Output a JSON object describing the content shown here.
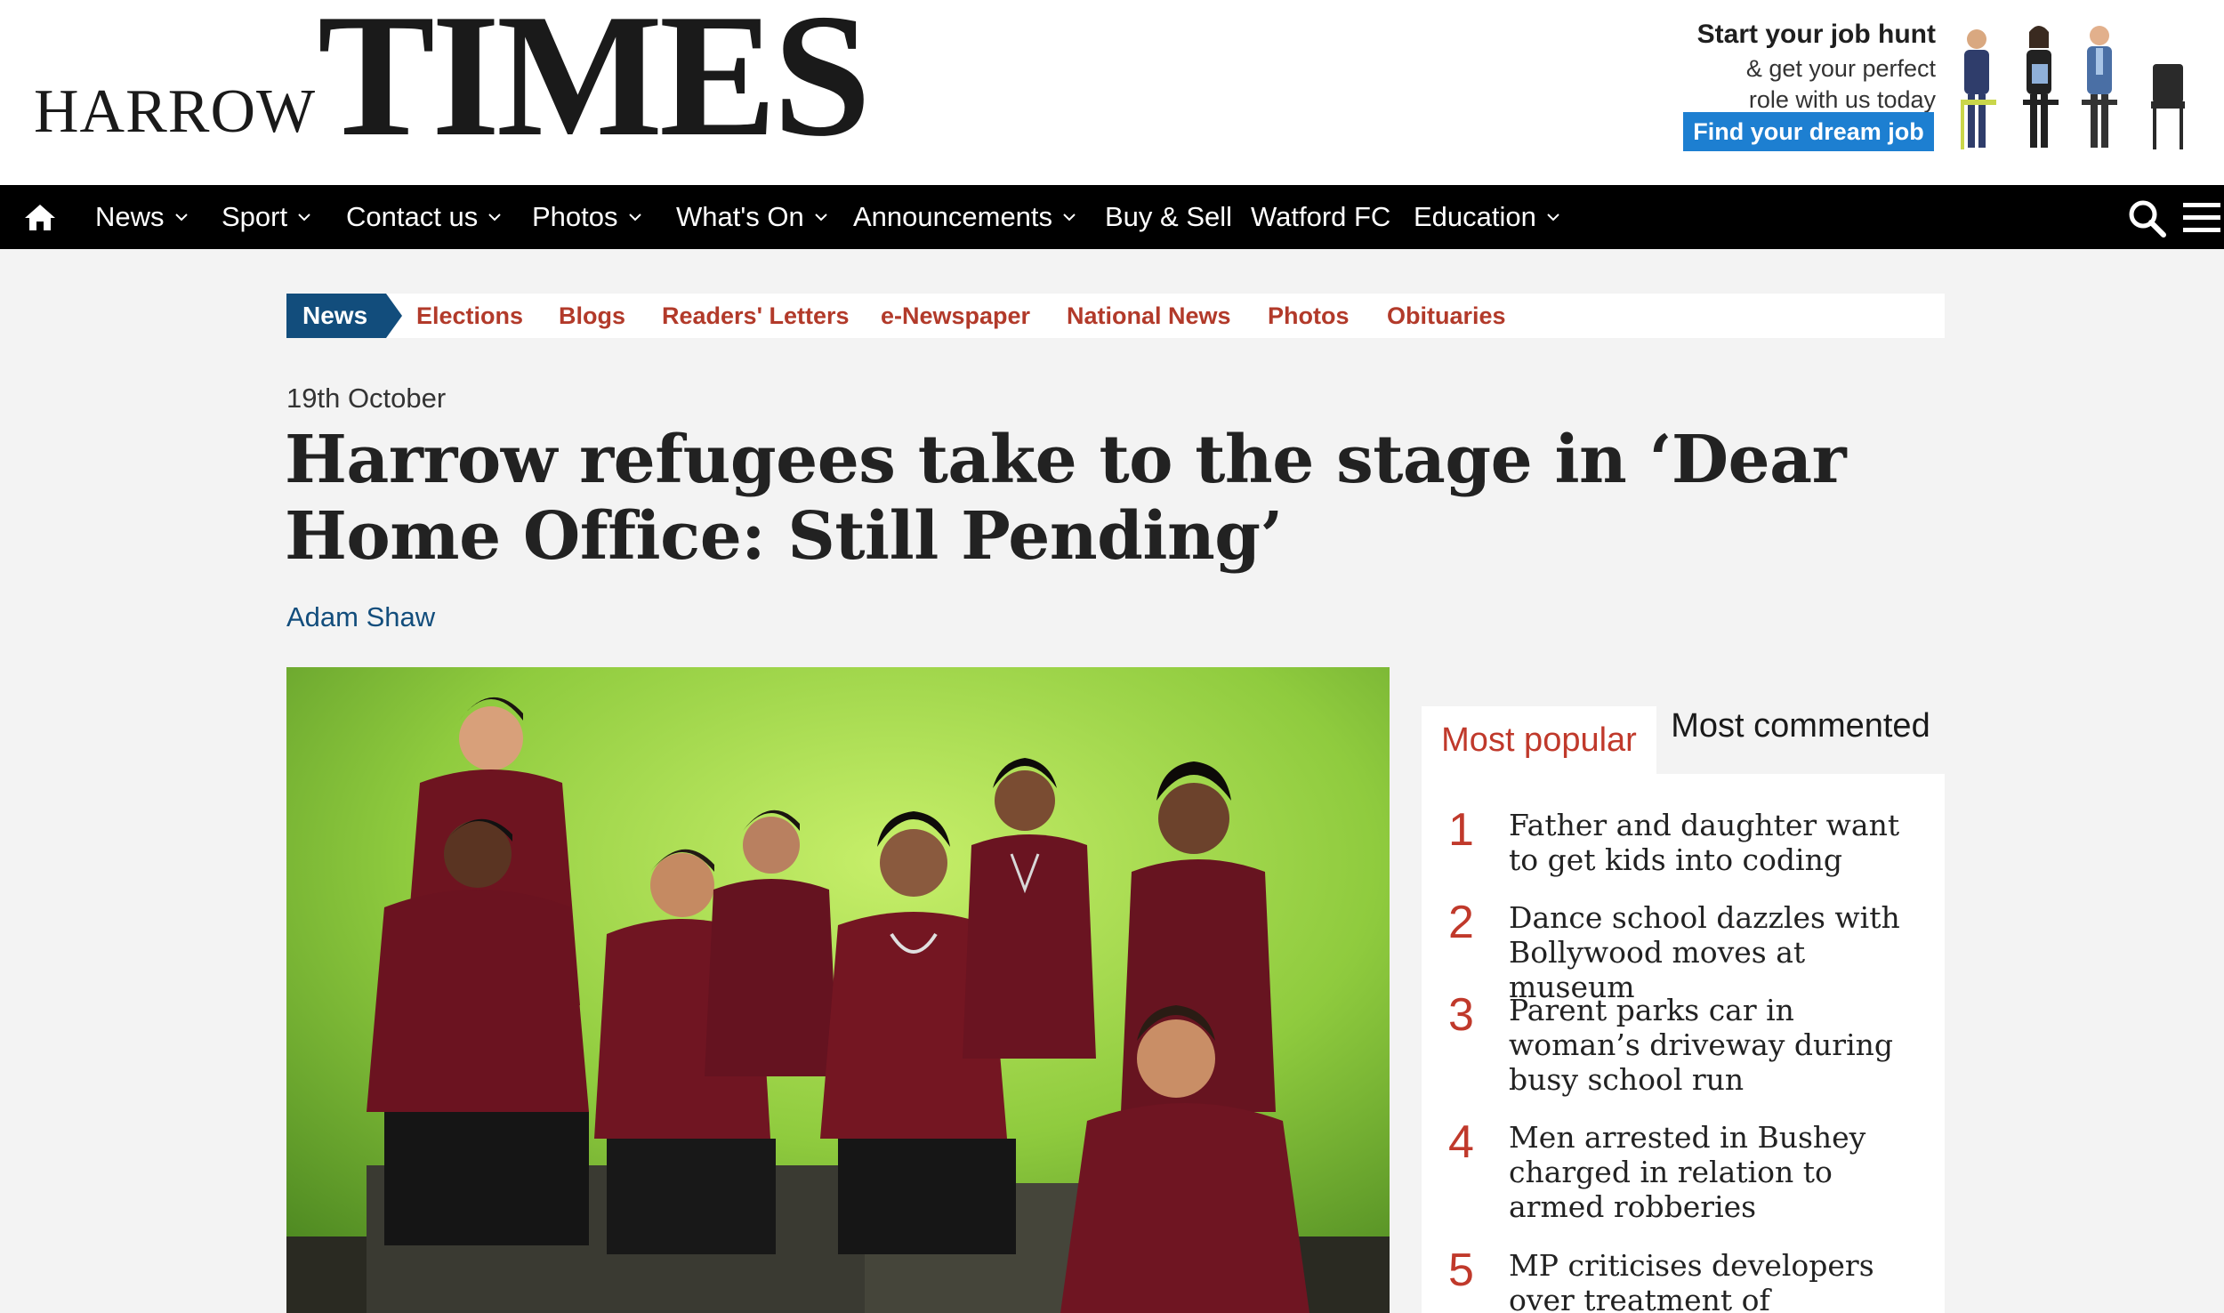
{
  "masthead": {
    "logo_small": "HARROW",
    "logo_large": "TIMES"
  },
  "ad": {
    "headline": "Start your job hunt",
    "line1": "& get your perfect",
    "line2": "role with us today",
    "button": "Find your dream job"
  },
  "nav": {
    "items": [
      "News",
      "Sport",
      "Contact us",
      "Photos",
      "What's On",
      "Announcements",
      "Buy & Sell",
      "Watford FC",
      "Education"
    ]
  },
  "section_nav": {
    "active": "News",
    "items": [
      "Elections",
      "Blogs",
      "Readers' Letters",
      "e-Newspaper",
      "National News",
      "Photos",
      "Obituaries"
    ]
  },
  "article": {
    "date": "19th October",
    "headline": "Harrow refugees take to the stage in ‘Dear Home Office: Still Pending’",
    "author": "Adam Shaw"
  },
  "sidebar": {
    "tab_popular": "Most popular",
    "tab_commented": "Most commented",
    "items": [
      {
        "num": "1",
        "title": "Father and daughter want to get kids into coding"
      },
      {
        "num": "2",
        "title": "Dance school dazzles with Bollywood moves at museum"
      },
      {
        "num": "3",
        "title": "Parent parks car in woman’s driveway during busy school run"
      },
      {
        "num": "4",
        "title": "Men arrested in Bushey charged in relation to armed robberies"
      },
      {
        "num": "5",
        "title": "MP criticises developers over treatment of leaseholders"
      }
    ]
  },
  "colors": {
    "nav_bg": "#000000",
    "section_active": "#124d7c",
    "section_link": "#b23a2a",
    "accent_red": "#c0392b",
    "author_link": "#124d7c",
    "ad_button": "#1d7fd1"
  }
}
